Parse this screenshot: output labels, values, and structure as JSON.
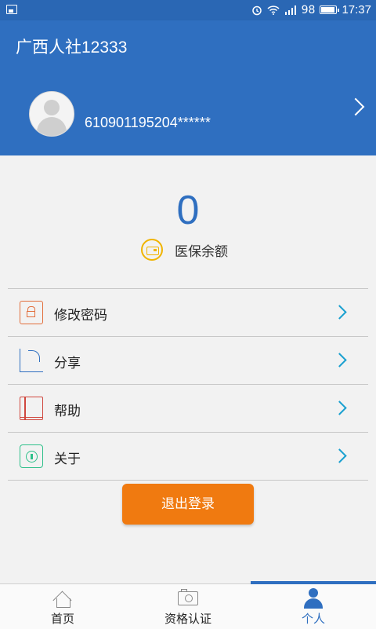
{
  "status_bar": {
    "battery": "98",
    "time": "17:37"
  },
  "header": {
    "title": "广西人社12333"
  },
  "profile": {
    "id_number": "610901195204******"
  },
  "balance": {
    "value": "0",
    "label": "医保余额"
  },
  "menu": [
    {
      "label": "修改密码",
      "icon": "lock-icon"
    },
    {
      "label": "分享",
      "icon": "share-icon"
    },
    {
      "label": "帮助",
      "icon": "book-icon"
    },
    {
      "label": "关于",
      "icon": "info-icon"
    }
  ],
  "logout": {
    "label": "退出登录"
  },
  "tabs": [
    {
      "label": "首页",
      "icon": "home-icon"
    },
    {
      "label": "资格认证",
      "icon": "camera-icon"
    },
    {
      "label": "个人",
      "icon": "person-icon",
      "active": true
    }
  ],
  "colors": {
    "primary": "#2f6fc0",
    "accent": "#f07a10"
  }
}
